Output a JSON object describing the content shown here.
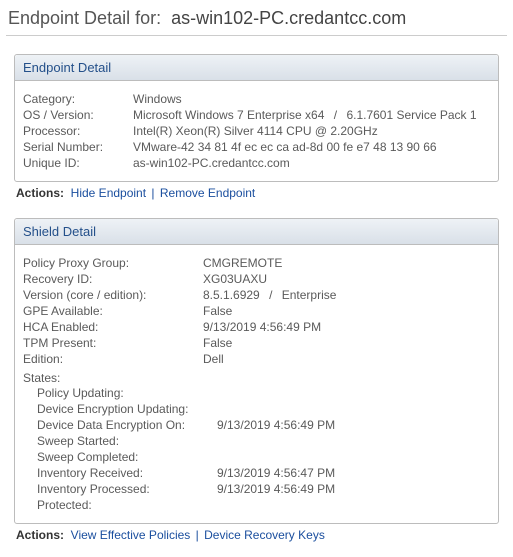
{
  "page": {
    "title_prefix": "Endpoint Detail for:",
    "hostname": "as-win102-PC.credantcc.com"
  },
  "endpoint_panel": {
    "header": "Endpoint Detail",
    "rows": {
      "category_label": "Category:",
      "category_value": "Windows",
      "os_label": "OS / Version:",
      "os_value_a": "Microsoft Windows 7 Enterprise x64",
      "os_value_b": "6.1.7601 Service Pack 1",
      "processor_label": "Processor:",
      "processor_value": "Intel(R) Xeon(R) Silver 4114 CPU @ 2.20GHz",
      "serial_label": "Serial Number:",
      "serial_value": "VMware-42 34 81 4f ec ec ca ad-8d 00 fe e7 48 13 90 66",
      "unique_label": "Unique ID:",
      "unique_value": "as-win102-PC.credantcc.com"
    }
  },
  "endpoint_actions": {
    "label": "Actions:",
    "hide": "Hide Endpoint",
    "remove": "Remove Endpoint"
  },
  "shield_panel": {
    "header": "Shield Detail",
    "rows": {
      "ppg_label": "Policy Proxy Group:",
      "ppg_value": "CMGREMOTE",
      "recovery_label": "Recovery ID:",
      "recovery_value": "XG03UAXU",
      "version_label": "Version (core / edition):",
      "version_value_a": "8.5.1.6929",
      "version_value_b": "Enterprise",
      "gpe_label": "GPE Available:",
      "gpe_value": "False",
      "hca_label": "HCA Enabled:",
      "hca_value": "9/13/2019 4:56:49 PM",
      "tpm_label": "TPM Present:",
      "tpm_value": "False",
      "edition_label": "Edition:",
      "edition_value": "Dell"
    },
    "states_label": "States:",
    "states": {
      "policy_updating_label": "Policy Updating:",
      "policy_updating_value": "",
      "dev_enc_updating_label": "Device Encryption Updating:",
      "dev_enc_updating_value": "",
      "dev_data_enc_on_label": "Device Data Encryption On:",
      "dev_data_enc_on_value": "9/13/2019 4:56:49 PM",
      "sweep_started_label": "Sweep Started:",
      "sweep_started_value": "",
      "sweep_completed_label": "Sweep Completed:",
      "sweep_completed_value": "",
      "inv_received_label": "Inventory Received:",
      "inv_received_value": "9/13/2019 4:56:47 PM",
      "inv_processed_label": "Inventory Processed:",
      "inv_processed_value": "9/13/2019 4:56:49 PM",
      "protected_label": "Protected:",
      "protected_value": ""
    }
  },
  "shield_actions": {
    "label": "Actions:",
    "view_policies": "View Effective Policies",
    "recovery_keys": "Device Recovery Keys"
  },
  "slash": "/"
}
